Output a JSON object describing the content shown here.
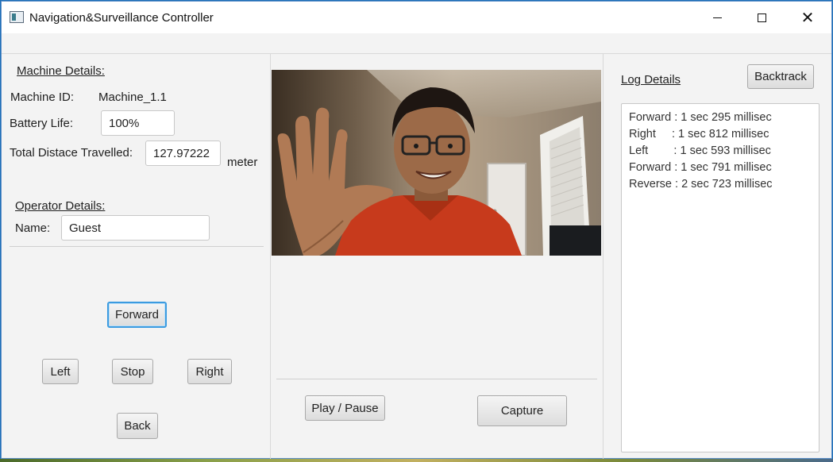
{
  "window": {
    "title": "Navigation&Surveillance Controller",
    "min_glyph": "",
    "close_glyph": "✕"
  },
  "machine": {
    "heading": "Machine Details:",
    "id_label": "Machine ID:",
    "id_value": "Machine_1.1",
    "battery_label": "Battery Life:",
    "battery_value": "100%",
    "distance_label": "Total Distace Travelled:",
    "distance_value": "127.97222",
    "distance_unit": "meter"
  },
  "operator": {
    "heading": "Operator Details:",
    "name_label": "Name:",
    "name_value": "Guest"
  },
  "controls": {
    "forward": "Forward",
    "left": "Left",
    "stop": "Stop",
    "right": "Right",
    "back": "Back"
  },
  "video": {
    "play_pause": "Play / Pause",
    "capture": "Capture"
  },
  "log": {
    "heading": "Log Details",
    "backtrack": "Backtrack",
    "entries": [
      "Forward : 1 sec 295 millisec",
      "Right     : 1 sec 812 millisec",
      "Left        : 1 sec 593 millisec",
      "Forward : 1 sec 791 millisec",
      "Reverse : 2 sec 723 millisec"
    ]
  },
  "colors": {
    "focus_ring": "#3b9be0",
    "window_bg": "#f3f3f3"
  }
}
